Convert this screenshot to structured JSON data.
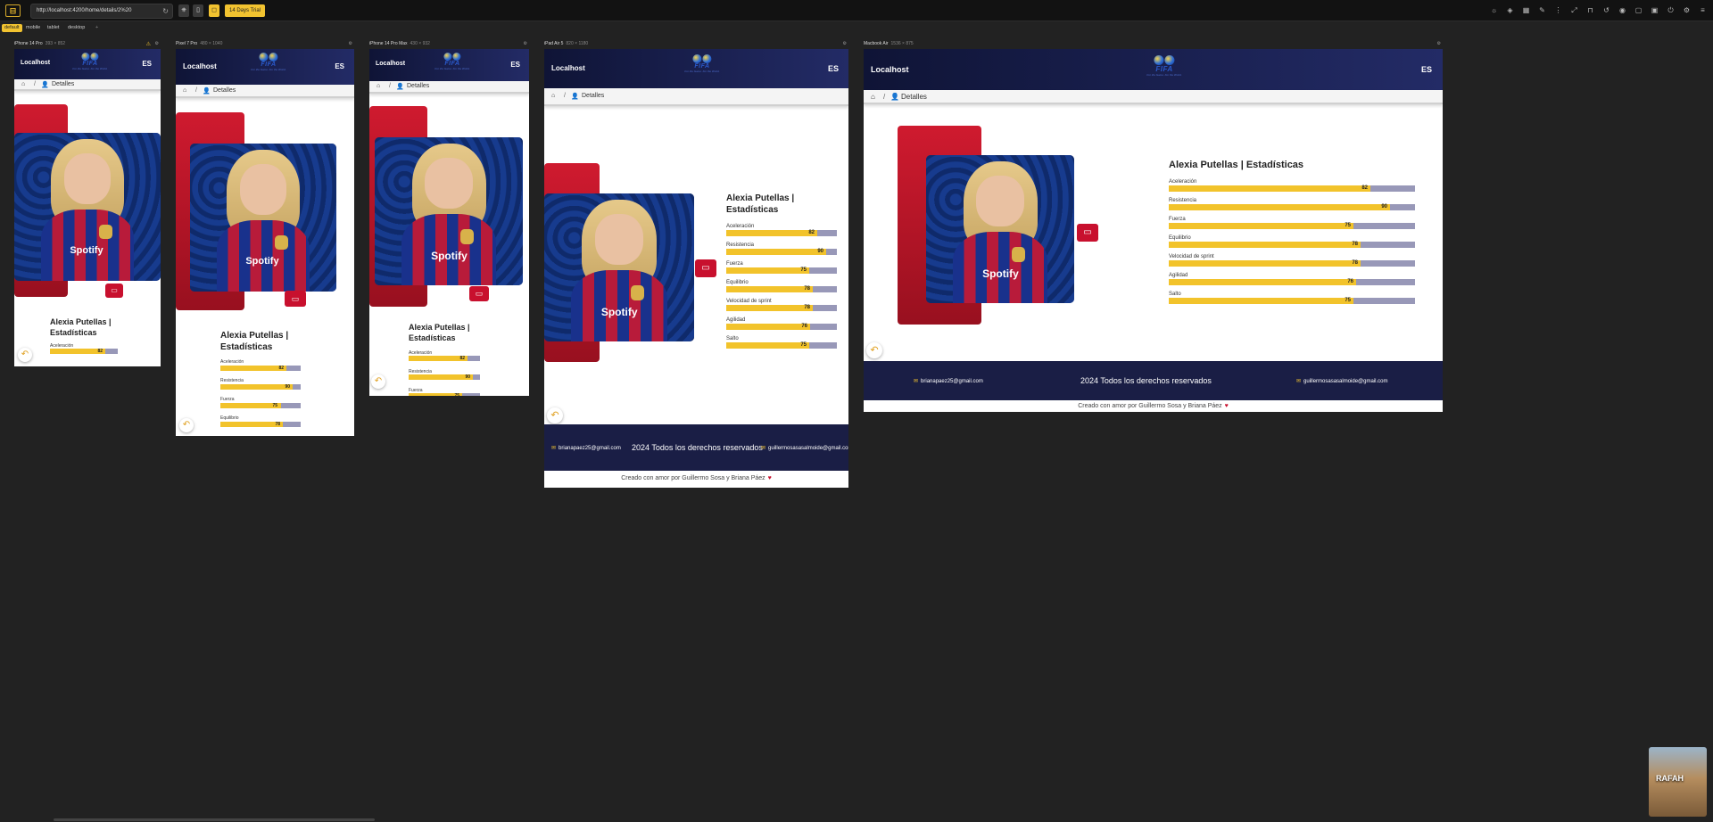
{
  "toolbar": {
    "url": "http://localhost:4200/home/details/2%20",
    "trial": "14 Days Trial",
    "tabs": [
      "default",
      "mobile",
      "tablet",
      "desktop",
      "+"
    ]
  },
  "app": {
    "brand": "Localhost",
    "lang": "ES",
    "logo_word": "FIFA",
    "logo_tag": "For the Game. For the World.",
    "breadcrumb": "Detalles",
    "title": "Alexia Putellas | Estadísticas",
    "stats": [
      {
        "label": "Aceleración",
        "value": 82
      },
      {
        "label": "Resistencia",
        "value": 90
      },
      {
        "label": "Fuerza",
        "value": 75
      },
      {
        "label": "Equilibrio",
        "value": 78
      },
      {
        "label": "Velocidad de sprint",
        "value": 78
      },
      {
        "label": "Agilidad",
        "value": 76
      },
      {
        "label": "Salto",
        "value": 75
      }
    ],
    "footer_email_1": "brianapaez25@gmail.com",
    "footer_email_2": "guillermosasasalmoide@gmail.com",
    "footer_rights": "2024 Todos los derechos reservados",
    "made_with": "Creado con amor por Guillermo Sosa y Briana Páez",
    "sponsor": "Spotify"
  },
  "devices": [
    {
      "name": "iPhone 14 Pro",
      "size": "393 × 852"
    },
    {
      "name": "Pixel 7 Pro",
      "size": "480 × 1040"
    },
    {
      "name": "iPhone 14 Pro Max",
      "size": "430 × 932"
    },
    {
      "name": "iPad Air 5",
      "size": "820 × 1180"
    },
    {
      "name": "Macbook Air",
      "size": "1536 × 875"
    }
  ],
  "icons": {
    "home": "home-icon",
    "user": "user-icon",
    "back": "back-arrow-icon",
    "tv": "tv-icon",
    "mail": "mail-icon",
    "heart": "heart-icon"
  },
  "colors": {
    "header": "#1a1e45",
    "bar_fill": "#f2c32b",
    "bar_empty": "#9898b8",
    "red": "#c8102e",
    "accent": "#f2c330"
  },
  "thumbnail_text": "RAFAH"
}
